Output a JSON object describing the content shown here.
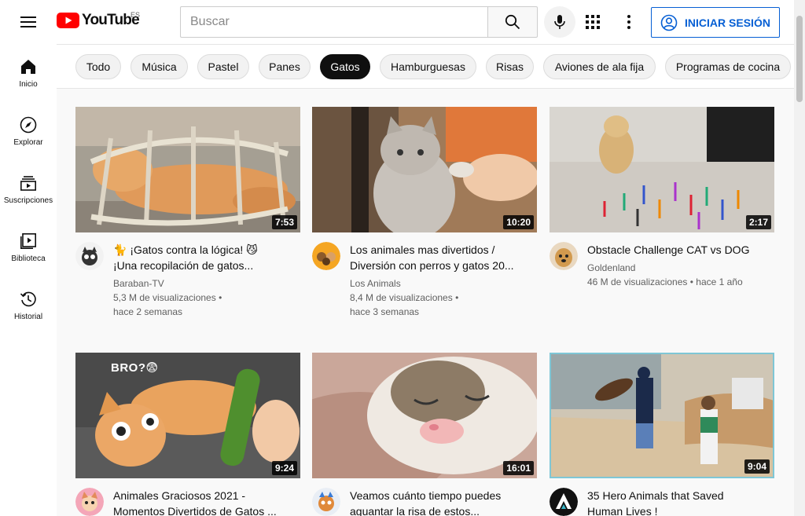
{
  "header": {
    "logo_text": "YouTube",
    "country": "ES",
    "search_placeholder": "Buscar",
    "signin_label": "INICIAR SESIÓN",
    "brand_red": "#ff0000",
    "accent_blue": "#065fd4"
  },
  "sidebar": {
    "items": [
      {
        "label": "Inicio",
        "icon": "home-icon"
      },
      {
        "label": "Explorar",
        "icon": "compass-icon"
      },
      {
        "label": "Suscripciones",
        "icon": "subscriptions-icon"
      },
      {
        "label": "Biblioteca",
        "icon": "library-icon"
      },
      {
        "label": "Historial",
        "icon": "history-icon"
      }
    ]
  },
  "chips": [
    {
      "label": "Todo",
      "active": false
    },
    {
      "label": "Música",
      "active": false
    },
    {
      "label": "Pastel",
      "active": false
    },
    {
      "label": "Panes",
      "active": false
    },
    {
      "label": "Gatos",
      "active": true
    },
    {
      "label": "Hamburguesas",
      "active": false
    },
    {
      "label": "Risas",
      "active": false
    },
    {
      "label": "Aviones de ala fija",
      "active": false
    },
    {
      "label": "Programas de cocina",
      "active": false
    }
  ],
  "videos": [
    {
      "title_line1": "🐈 ¡Gatos contra la lógica! 😼",
      "title_line2": "¡Una recopilación de gatos...",
      "channel": "Baraban-TV",
      "views": "5,3 M de visualizaciones •",
      "age": "hace 2 semanas",
      "duration": "7:53"
    },
    {
      "title_line1": "Los animales mas divertidos /",
      "title_line2": "Diversión con perros y gatos 20...",
      "channel": "Los Animals",
      "views": "8,4 M de visualizaciones •",
      "age": "hace 3 semanas",
      "duration": "10:20"
    },
    {
      "title_line1": "Obstacle Challenge CAT vs DOG",
      "title_line2": "",
      "channel": "Goldenland",
      "views": "46 M de visualizaciones • hace 1 año",
      "age": "",
      "duration": "2:17"
    },
    {
      "title_line1": "Animales Graciosos 2021 -",
      "title_line2": "Momentos Divertidos de Gatos ...",
      "channel": "",
      "views": "",
      "age": "",
      "duration": "9:24",
      "overlay_text": "BRO?😨"
    },
    {
      "title_line1": "Veamos cuánto tiempo puedes",
      "title_line2": "aguantar la risa de estos...",
      "channel": "",
      "views": "",
      "age": "",
      "duration": "16:01"
    },
    {
      "title_line1": "35 Hero Animals that Saved",
      "title_line2": "Human Lives !",
      "channel": "",
      "views": "",
      "age": "",
      "duration": "9:04"
    }
  ]
}
